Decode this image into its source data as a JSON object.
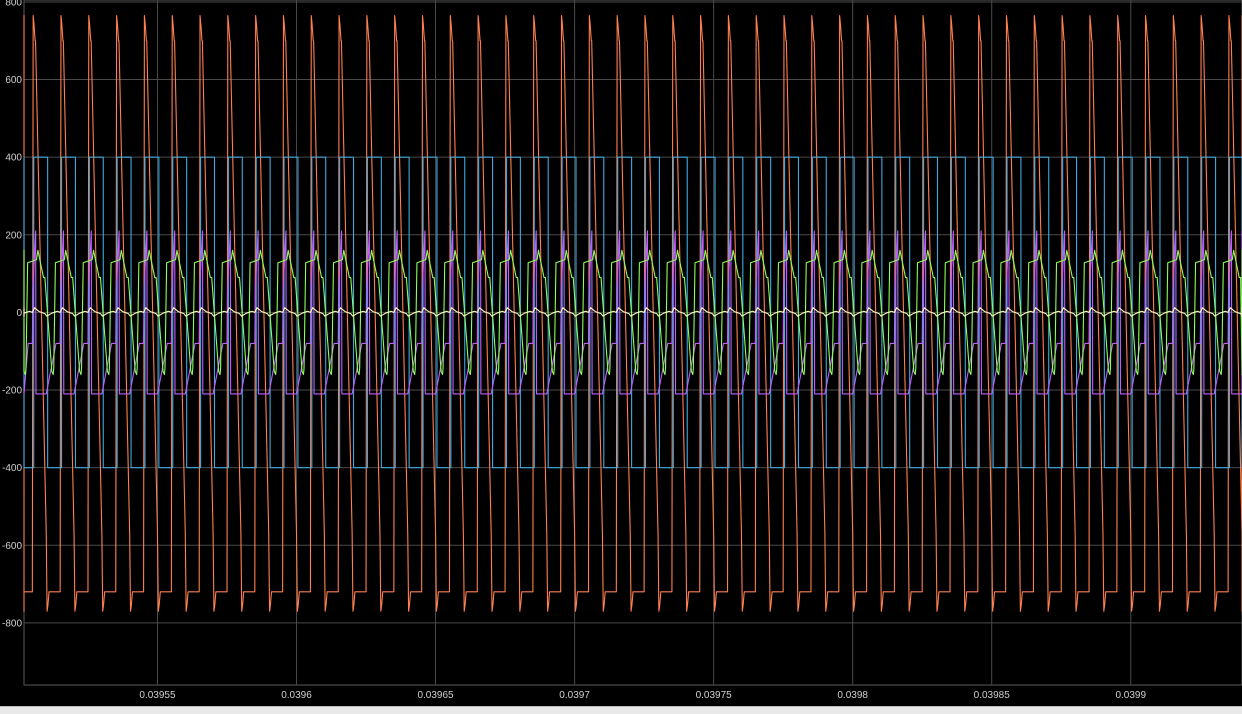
{
  "chart_data": {
    "type": "line",
    "title": "",
    "xlabel": "",
    "ylabel": "",
    "xlim": [
      0.039502,
      0.03994
    ],
    "ylim": [
      -960,
      805
    ],
    "grid": true,
    "background": "#000000",
    "grid_color": "#4a4a4a",
    "xticks": [
      0.03955,
      0.0396,
      0.03965,
      0.0397,
      0.03975,
      0.0398,
      0.03985,
      0.0399
    ],
    "xtick_labels": [
      "0.03955",
      "0.0396",
      "0.03965",
      "0.0397",
      "0.03975",
      "0.0398",
      "0.03985",
      "0.0399"
    ],
    "yticks": [
      800,
      600,
      400,
      200,
      0,
      -200,
      -400,
      -600,
      -800
    ],
    "ytick_labels": [
      "800",
      "600",
      "400",
      "200",
      "0",
      "-200",
      "-400",
      "-600",
      "-800"
    ],
    "switching_period": 1e-05,
    "first_rising_edge": 0.039505,
    "series": [
      {
        "color": "#ff7f4f",
        "shape": "spike",
        "description_values": {
          "pos_peak": 765,
          "pos_end": 700,
          "neg_peak": -770,
          "neg_end": -720,
          "fall_start": 1e-06,
          "rise_time": 3e-07
        }
      },
      {
        "color": "#3fa9e0",
        "shape": "square",
        "description_values": {
          "high": 400,
          "low": -400,
          "phase": 5e-07
        }
      },
      {
        "color": "#c45cff",
        "shape": "ramp",
        "description_values": {
          "peak": 210,
          "trough": -210,
          "flat": -80
        }
      },
      {
        "color": "#8cff5c",
        "shape": "sawtooth",
        "description_values": {
          "high": 160,
          "mid": 90,
          "low": -160
        }
      },
      {
        "color": "#fffcc0",
        "shape": "ripple",
        "description_values": {
          "amplitude": 12,
          "offset": 0
        }
      }
    ]
  }
}
